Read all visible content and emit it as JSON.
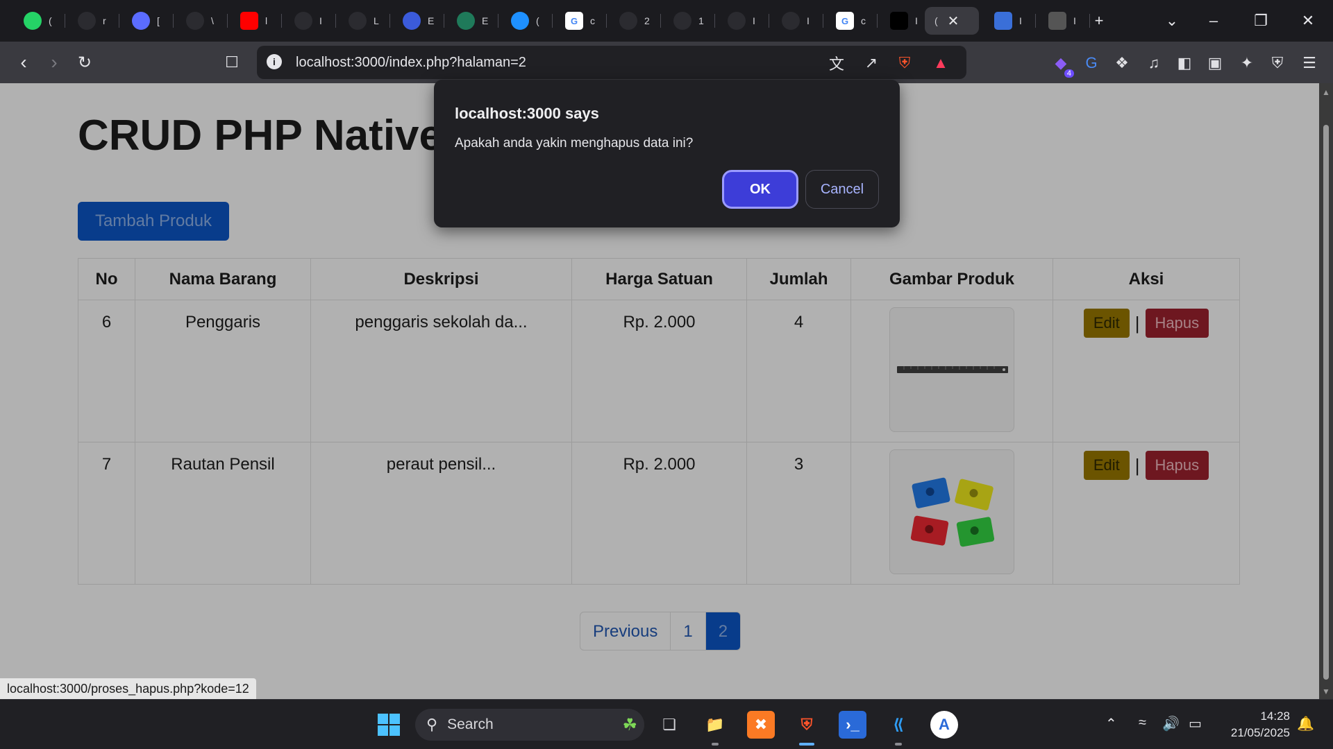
{
  "tabs": [
    {
      "icon": "whatsapp-icon",
      "label": "(",
      "bg": "#25d366"
    },
    {
      "icon": "github-icon",
      "label": "r",
      "bg": "#2b2b30"
    },
    {
      "icon": "copilot-icon",
      "label": "[",
      "bg": "#5b6cff"
    },
    {
      "icon": "openai-icon",
      "label": "\\",
      "bg": "#2b2b30"
    },
    {
      "icon": "youtube-icon",
      "label": "l",
      "bg": "#ff0000"
    },
    {
      "icon": "github-icon",
      "label": "I",
      "bg": "#2b2b30"
    },
    {
      "icon": "github-icon",
      "label": "L",
      "bg": "#2b2b30"
    },
    {
      "icon": "app-icon",
      "label": "E",
      "bg": "#3b5bdb"
    },
    {
      "icon": "globe-icon",
      "label": "E",
      "bg": "#1f7a5a"
    },
    {
      "icon": "cloud-icon",
      "label": "(",
      "bg": "#1e90ff"
    },
    {
      "icon": "google-icon",
      "label": "c",
      "bg": "#ffffff"
    },
    {
      "icon": "openai-icon",
      "label": "2",
      "bg": "#2b2b30"
    },
    {
      "icon": "openai-icon",
      "label": "1",
      "bg": "#2b2b30"
    },
    {
      "icon": "tailwind-icon",
      "label": "I",
      "bg": "#2b2b30"
    },
    {
      "icon": "pma-icon",
      "label": "I",
      "bg": "#2b2b30"
    },
    {
      "icon": "google-icon",
      "label": "c",
      "bg": "#ffffff"
    },
    {
      "icon": "ky-icon",
      "label": "I",
      "bg": "#000000"
    },
    {
      "icon": "active-tab",
      "label": "(",
      "bg": "#3a3a40"
    },
    {
      "icon": "contacts-icon",
      "label": "I",
      "bg": "#3a6fd8"
    },
    {
      "icon": "md-icon",
      "label": "I",
      "bg": "#555555"
    }
  ],
  "browser": {
    "url": "localhost:3000/index.php?halaman=2",
    "extension_badge": "4"
  },
  "page": {
    "title": "CRUD PHP Native",
    "add_button": "Tambah Produk",
    "table": {
      "headers": [
        "No",
        "Nama Barang",
        "Deskripsi",
        "Harga Satuan",
        "Jumlah",
        "Gambar Produk",
        "Aksi"
      ],
      "rows": [
        {
          "no": "6",
          "nama": "Penggaris",
          "deskripsi": "penggaris sekolah da...",
          "harga": "Rp. 2.000",
          "jumlah": "4",
          "image": "ruler-image"
        },
        {
          "no": "7",
          "nama": "Rautan Pensil",
          "deskripsi": "peraut pensil...",
          "harga": "Rp. 2.000",
          "jumlah": "3",
          "image": "sharpener-image"
        }
      ],
      "edit_label": "Edit",
      "hapus_label": "Hapus",
      "separator": "|"
    },
    "pagination": {
      "previous": "Previous",
      "pages": [
        "1",
        "2"
      ],
      "current": "2"
    },
    "status_url": "localhost:3000/proses_hapus.php?kode=12"
  },
  "dialog": {
    "title": "localhost:3000 says",
    "message": "Apakah anda yakin menghapus data ini?",
    "ok": "OK",
    "cancel": "Cancel"
  },
  "taskbar": {
    "search_placeholder": "Search",
    "time": "14:28",
    "date": "21/05/2025"
  },
  "colors": {
    "accent": "#0b4db3",
    "dialog_ok": "#3d3dd8",
    "edit": "#8a6c00",
    "hapus": "#8e1e2a"
  }
}
